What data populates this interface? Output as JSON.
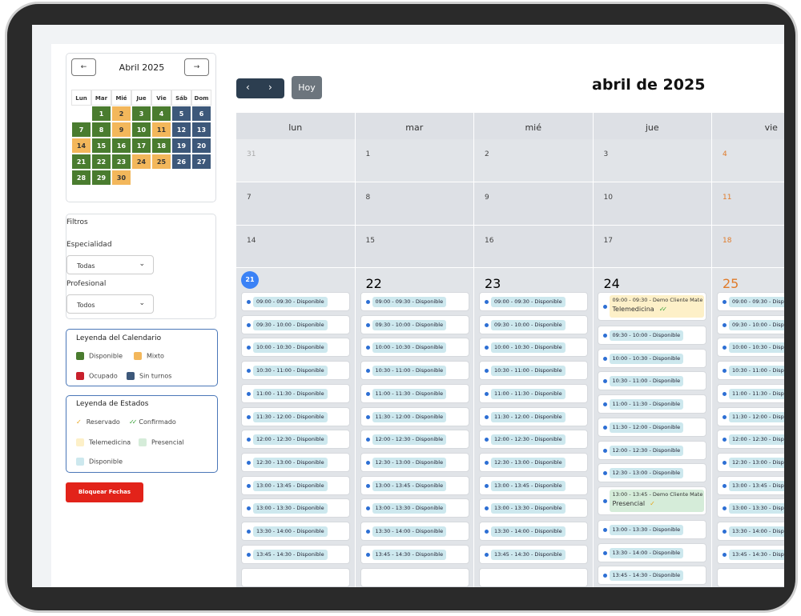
{
  "mini": {
    "prev": "←",
    "next": "→",
    "title": "Abril 2025",
    "weekdays": [
      "Lun",
      "Mar",
      "Mié",
      "Jue",
      "Vie",
      "Sáb",
      "Dom"
    ],
    "days": [
      {
        "t": "",
        "c": ""
      },
      {
        "t": "1",
        "c": "#4a7c2f"
      },
      {
        "t": "2",
        "c": "#f3b75b"
      },
      {
        "t": "3",
        "c": "#4a7c2f"
      },
      {
        "t": "4",
        "c": "#4a7c2f"
      },
      {
        "t": "5",
        "c": "#3d587a"
      },
      {
        "t": "6",
        "c": "#3d587a"
      },
      {
        "t": "7",
        "c": "#4a7c2f"
      },
      {
        "t": "8",
        "c": "#4a7c2f"
      },
      {
        "t": "9",
        "c": "#f3b75b"
      },
      {
        "t": "10",
        "c": "#4a7c2f"
      },
      {
        "t": "11",
        "c": "#f3b75b"
      },
      {
        "t": "12",
        "c": "#3d587a"
      },
      {
        "t": "13",
        "c": "#3d587a"
      },
      {
        "t": "14",
        "c": "#f3b75b"
      },
      {
        "t": "15",
        "c": "#4a7c2f"
      },
      {
        "t": "16",
        "c": "#4a7c2f"
      },
      {
        "t": "17",
        "c": "#4a7c2f"
      },
      {
        "t": "18",
        "c": "#4a7c2f"
      },
      {
        "t": "19",
        "c": "#3d587a"
      },
      {
        "t": "20",
        "c": "#3d587a"
      },
      {
        "t": "21",
        "c": "#4a7c2f"
      },
      {
        "t": "22",
        "c": "#4a7c2f"
      },
      {
        "t": "23",
        "c": "#4a7c2f"
      },
      {
        "t": "24",
        "c": "#f3b75b"
      },
      {
        "t": "25",
        "c": "#f3b75b"
      },
      {
        "t": "26",
        "c": "#3d587a"
      },
      {
        "t": "27",
        "c": "#3d587a"
      },
      {
        "t": "28",
        "c": "#4a7c2f"
      },
      {
        "t": "29",
        "c": "#4a7c2f"
      },
      {
        "t": "30",
        "c": "#f3b75b"
      }
    ]
  },
  "filters": {
    "title": "Filtros",
    "specialty_label": "Especialidad",
    "specialty_value": "Todas",
    "professional_label": "Profesional",
    "professional_value": "Todos"
  },
  "legend_calendar": {
    "title": "Leyenda del Calendario",
    "items": [
      {
        "label": "Disponible",
        "color": "#4a7c2f"
      },
      {
        "label": "Mixto",
        "color": "#f3b75b"
      },
      {
        "label": "Ocupado",
        "color": "#c8202c"
      },
      {
        "label": "Sin turnos",
        "color": "#3d587a"
      }
    ]
  },
  "legend_status": {
    "title": "Leyenda de Estados",
    "reservado_icon": "✓",
    "reservado": "Reservado",
    "confirmado_icon": "✓✓",
    "confirmado": "Confirmado",
    "telemedicina": "Telemedicina",
    "presencial": "Presencial",
    "disponible": "Disponible",
    "colors": {
      "telemedicina": "#fdf0c8",
      "presencial": "#d5ecd9",
      "disponible": "#cde8ee"
    }
  },
  "block_button": "Bloquear Fechas",
  "toolbar": {
    "prev": "‹",
    "next": "›",
    "today": "Hoy"
  },
  "calendar": {
    "title": "abril de 2025",
    "headers": [
      "lun",
      "mar",
      "mié",
      "jue",
      "vie"
    ],
    "weeks": [
      [
        "31",
        "1",
        "2",
        "3",
        "4"
      ],
      [
        "7",
        "8",
        "9",
        "10",
        "11"
      ],
      [
        "14",
        "15",
        "16",
        "17",
        "18"
      ],
      [
        "21",
        "22",
        "23",
        "24",
        "25"
      ]
    ],
    "slots": [
      "09:00 - 09:30 - Disponible",
      "09:30 - 10:00 - Disponible",
      "10:00 - 10:30 - Disponible",
      "10:30 - 11:00 - Disponible",
      "11:00 - 11:30 - Disponible",
      "11:30 - 12:00 - Disponible",
      "12:00 - 12:30 - Disponible",
      "12:30 - 13:00 - Disponible",
      "13:00 - 13:45 - Disponible",
      "13:00 - 13:30 - Disponible",
      "13:30 - 14:00 - Disponible",
      "13:45 - 14:30 - Disponible"
    ],
    "thursday": [
      {
        "kind": "booked",
        "text": "09:00 - 09:30 - Demo Cliente Mate",
        "sub": "Telemedicina",
        "icon": "✓✓",
        "bg": "#fdf0c8"
      },
      {
        "kind": "slot",
        "text": "09:30 - 10:00 - Disponible"
      },
      {
        "kind": "slot",
        "text": "10:00 - 10:30 - Disponible"
      },
      {
        "kind": "slot",
        "text": "10:30 - 11:00 - Disponible"
      },
      {
        "kind": "slot",
        "text": "11:00 - 11:30 - Disponible"
      },
      {
        "kind": "slot",
        "text": "11:30 - 12:00 - Disponible"
      },
      {
        "kind": "slot",
        "text": "12:00 - 12:30 - Disponible"
      },
      {
        "kind": "slot",
        "text": "12:30 - 13:00 - Disponible"
      },
      {
        "kind": "booked",
        "text": "13:00 - 13:45 - Demo Cliente Mate",
        "sub": "Presencial",
        "icon": "✓",
        "bg": "#d5ecd9"
      },
      {
        "kind": "slot",
        "text": "13:00 - 13:30 - Disponible"
      },
      {
        "kind": "slot",
        "text": "13:30 - 14:00 - Disponible"
      },
      {
        "kind": "slot",
        "text": "13:45 - 14:30 - Disponible"
      }
    ]
  }
}
